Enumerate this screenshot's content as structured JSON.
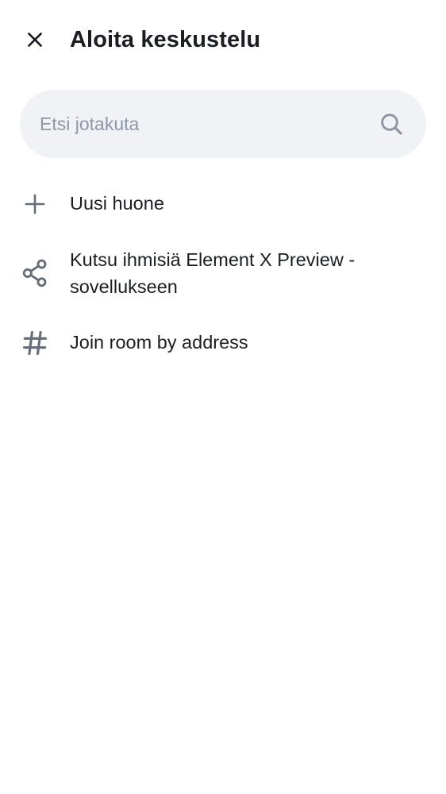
{
  "header": {
    "title": "Aloita keskustelu",
    "close_icon": "close-icon"
  },
  "search": {
    "placeholder": "Etsi jotakuta",
    "value": "",
    "icon": "search-icon"
  },
  "menu": {
    "items": [
      {
        "label": "Uusi huone",
        "icon": "plus-icon"
      },
      {
        "label": "Kutsu ihmisiä Element X Preview -sovellukseen",
        "icon": "share-icon"
      },
      {
        "label": "Join room by address",
        "icon": "hash-icon"
      }
    ]
  },
  "colors": {
    "background": "#ffffff",
    "text_primary": "#1b1d22",
    "text_placeholder": "#8d97a5",
    "icon": "#656d77",
    "search_background": "#f0f2f5"
  }
}
